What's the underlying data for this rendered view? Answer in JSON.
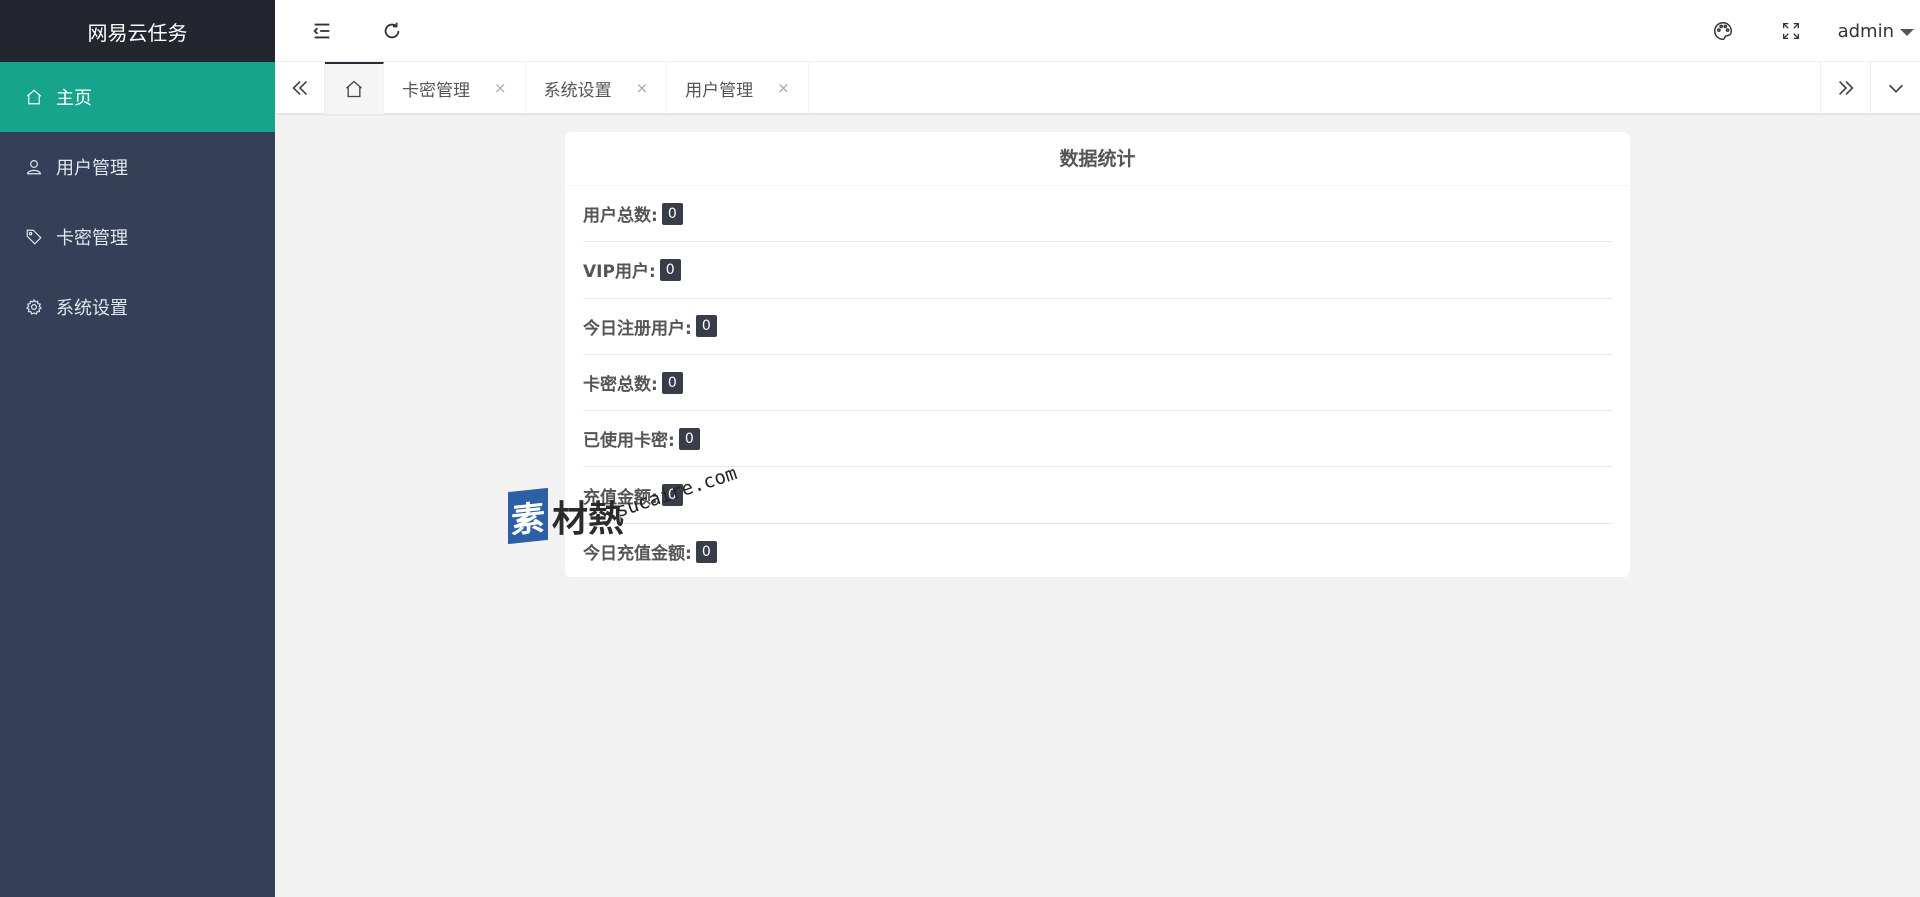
{
  "app": {
    "title": "网易云任务"
  },
  "sidebar": {
    "items": [
      {
        "label": "主页",
        "icon": "home-icon",
        "active": true
      },
      {
        "label": "用户管理",
        "icon": "user-icon",
        "active": false
      },
      {
        "label": "卡密管理",
        "icon": "tag-icon",
        "active": false
      },
      {
        "label": "系统设置",
        "icon": "gear-icon",
        "active": false
      }
    ]
  },
  "header": {
    "user_name": "admin",
    "icons": [
      "menu-collapse-icon",
      "refresh-icon",
      "palette-icon",
      "fullscreen-icon",
      "chevron-down-icon"
    ]
  },
  "tabs": {
    "items": [
      {
        "label": "卡密管理",
        "close": "×"
      },
      {
        "label": "系统设置",
        "close": "×"
      },
      {
        "label": "用户管理",
        "close": "×"
      }
    ]
  },
  "stats": {
    "title": "数据统计",
    "rows": [
      {
        "label": "用户总数:",
        "value": "0"
      },
      {
        "label": "VIP用户:",
        "value": "0"
      },
      {
        "label": "今日注册用户:",
        "value": "0"
      },
      {
        "label": "卡密总数:",
        "value": "0"
      },
      {
        "label": "已使用卡密:",
        "value": "0"
      },
      {
        "label": "充值金额:",
        "value": "0"
      },
      {
        "label": "今日充值金额:",
        "value": "0"
      }
    ]
  },
  "watermark": {
    "box": "素",
    "text": "材熱",
    "url": "sucaire.com"
  },
  "colors": {
    "sidebar_bg": "#344058",
    "logo_bg": "#23262e",
    "active": "#16a58c",
    "badge": "#393d49"
  }
}
